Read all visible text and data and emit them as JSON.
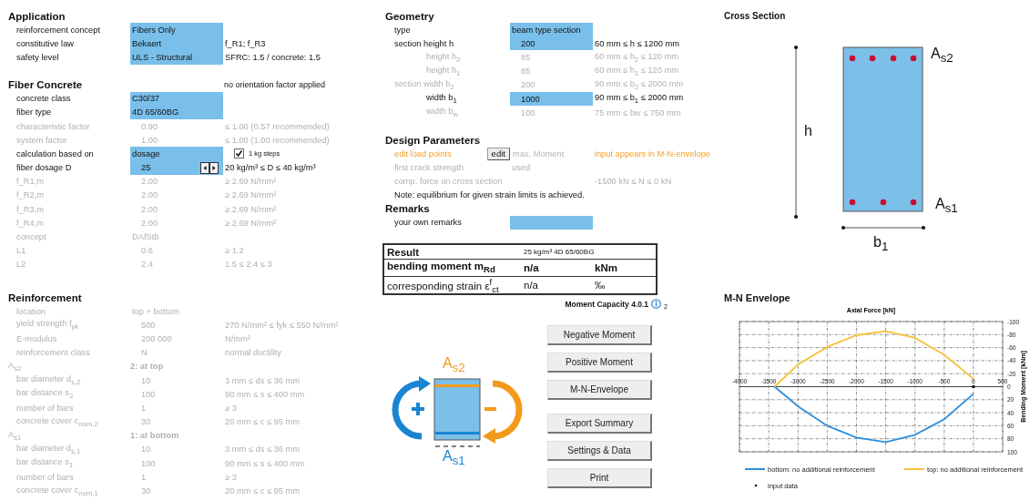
{
  "left_sections": [
    {
      "title": "Application",
      "rows": [
        {
          "label": "reinforcement concept",
          "value": "Fibers Only",
          "kind": "text",
          "input": true,
          "disabled": false
        },
        {
          "label": "constitutive law",
          "value": "Bekaert",
          "note": "f_R1; f_R3",
          "kind": "text",
          "input": true,
          "disabled": false
        },
        {
          "label": "safety level",
          "value": "ULS - Structural",
          "note": "SFRC: 1.5 / concrete: 1.5",
          "kind": "text",
          "input": true,
          "disabled": false
        }
      ]
    },
    {
      "title": "Fiber Concrete",
      "note": "no orientation factor applied",
      "rows": [
        {
          "label": "concrete class",
          "value": "C30/37",
          "kind": "text",
          "input": true,
          "disabled": false
        },
        {
          "label": "fiber type",
          "value": "4D 65/60BG",
          "kind": "text",
          "input": true,
          "disabled": false
        },
        {
          "label": "characteristic factor",
          "value": "0.90",
          "note": "≤ 1.00 (0.57 recommended)",
          "kind": "number",
          "input": false,
          "disabled": true
        },
        {
          "label": "system factor",
          "value": "1.00",
          "note": "≤ 1.00 (1.00 recommended)",
          "kind": "number",
          "input": false,
          "disabled": true
        },
        {
          "label": "calculation based on",
          "value": "dosage",
          "kind": "text",
          "input": true,
          "disabled": false,
          "checkbox": {
            "label": "1 kg steps",
            "checked": true
          }
        },
        {
          "label": "fiber dosage D",
          "value": "25",
          "note": "20 kg/m³ ≤ D ≤ 40 kg/m³",
          "kind": "stepper",
          "input": true,
          "disabled": false
        },
        {
          "label": "f_R1,m",
          "value": "2.00",
          "note": "≥ 2.69 N/mm²",
          "kind": "number",
          "input": false,
          "disabled": true
        },
        {
          "label": "f_R2,m",
          "value": "2.00",
          "note": "≥ 2.69 N/mm²",
          "kind": "number",
          "input": false,
          "disabled": true
        },
        {
          "label": "f_R3,m",
          "value": "2.00",
          "note": "≥ 2.69 N/mm²",
          "kind": "number",
          "input": false,
          "disabled": true
        },
        {
          "label": "f_R4,m",
          "value": "2.00",
          "note": "≥ 2.69 N/mm²",
          "kind": "number",
          "input": false,
          "disabled": true
        },
        {
          "label": "concept",
          "value": "DAfStb",
          "kind": "text",
          "input": false,
          "disabled": true
        },
        {
          "label": "L1",
          "value": "0.6",
          "note": "≥ 1.2",
          "kind": "number",
          "input": false,
          "disabled": true
        },
        {
          "label": "L2",
          "value": "2.4",
          "note": "1.5 ≤ 2.4 ≤ 3",
          "kind": "number",
          "input": false,
          "disabled": true
        }
      ]
    },
    {
      "title": "Reinforcement",
      "rows": [
        {
          "label": "location",
          "value": "top + bottom",
          "kind": "text",
          "input": false,
          "disabled": true
        },
        {
          "label": "yield strength f$_{yk}$",
          "value": "500",
          "note": "270 N/mm² ≤ fyk ≤ 550 N/mm²",
          "kind": "number",
          "input": false,
          "disabled": true
        },
        {
          "label": "E-modulus",
          "value": "200 000",
          "note": "N/mm²",
          "kind": "number",
          "input": false,
          "disabled": true
        },
        {
          "label": "reinforcement class",
          "value": "N",
          "note": "normal ductility",
          "kind": "number",
          "input": false,
          "disabled": true
        },
        {
          "label": "A$_{s2}$",
          "value": "2: at top",
          "kind": "group",
          "input": false,
          "disabled": true,
          "children": [
            {
              "label": "bar diameter d$_{s,2}$",
              "value": "10",
              "note": "3 mm ≤ ds ≤ 36 mm",
              "kind": "number",
              "input": false,
              "disabled": true
            },
            {
              "label": "bar distance s$_{2}$",
              "value": "100",
              "note": "90 mm ≤ s ≤ 400 mm",
              "kind": "number",
              "input": false,
              "disabled": true
            },
            {
              "label": "number of bars",
              "value": "1",
              "note": "≥ 3",
              "kind": "number",
              "input": false,
              "disabled": true
            },
            {
              "label": "concrete cover c$_{nom,2}$",
              "value": "30",
              "note": "20 mm ≤ c ≤ 95 mm",
              "kind": "number",
              "input": false,
              "disabled": true
            }
          ]
        },
        {
          "label": "A$_{s1}$",
          "value": "1: at bottom",
          "kind": "group",
          "input": false,
          "disabled": true,
          "children": [
            {
              "label": "bar diameter d$_{s,1}$",
              "value": "10",
              "note": "3 mm ≤ ds ≤ 36 mm",
              "kind": "number",
              "input": false,
              "disabled": true
            },
            {
              "label": "bar distance s$_{1}$",
              "value": "100",
              "note": "90 mm ≤ s ≤ 400 mm",
              "kind": "number",
              "input": false,
              "disabled": true
            },
            {
              "label": "number of bars",
              "value": "1",
              "note": "≥ 3",
              "kind": "number",
              "input": false,
              "disabled": true
            },
            {
              "label": "concrete cover c$_{nom,1}$",
              "value": "30",
              "note": "20 mm ≤ c ≤ 95 mm",
              "kind": "number",
              "input": false,
              "disabled": true
            }
          ]
        }
      ]
    }
  ],
  "middle_sections": [
    {
      "title": "Geometry",
      "rows": [
        {
          "label": "type",
          "value": "beam type section",
          "kind": "text",
          "input": true,
          "disabled": false
        },
        {
          "label": "section height h",
          "value": "200",
          "note": "60 mm ≤ h ≤ 1200 mm",
          "kind": "number",
          "input": true,
          "disabled": false,
          "children": [
            {
              "label": "height h$_{2}$",
              "value": "85",
              "note": "60 mm ≤ h$_{2}$ ≤ 120 mm",
              "kind": "number",
              "input": false,
              "disabled": true
            },
            {
              "label": "height h$_{1}$",
              "value": "85",
              "note": "60 mm ≤ h$_{1}$ ≤ 120 mm",
              "kind": "number",
              "input": false,
              "disabled": true
            }
          ]
        },
        {
          "label": "section width b$_{2}$",
          "value": "200",
          "note": "90 mm ≤ b$_{2}$ ≤ 2000 mm",
          "kind": "number",
          "input": false,
          "disabled": true,
          "children": [
            {
              "label": "width b$_{1}$",
              "value": "1000",
              "note": "90 mm ≤ b$_{1}$ ≤ 2000 mm",
              "kind": "number",
              "input": true,
              "disabled": false
            },
            {
              "label": "width b$_{w}$",
              "value": "100",
              "note": "75 mm ≤ bw ≤ 750 mm",
              "kind": "number",
              "input": false,
              "disabled": true
            }
          ]
        }
      ]
    },
    {
      "title": "Design Parameters",
      "footnote": "Note: equilibrium for given strain limits is achieved.",
      "rows": [
        {
          "label": "edit load points",
          "button": "edit",
          "value": "max. Moment",
          "note": "input appears in M-N-envelope",
          "kind": "action",
          "input": false,
          "disabled": false
        },
        {
          "label": "first crack strength",
          "value": "used",
          "kind": "text",
          "input": false,
          "disabled": true
        },
        {
          "label": "comp. force on cross section",
          "note": "-1500 kN ≤ N ≤ 0 kN",
          "kind": "text",
          "input": false,
          "disabled": true
        }
      ]
    },
    {
      "title": "Remarks",
      "rows": [
        {
          "label": "your own remarks",
          "kind": "text",
          "input": true,
          "disabled": false
        }
      ]
    }
  ],
  "result": {
    "title": "Result",
    "subtitle": "25 kg/m³ 4D 65/60BG",
    "rows": [
      {
        "label": "bending moment m$_{Rd}$",
        "value": "n/a",
        "unit": "kNm",
        "emphasis": true
      },
      {
        "label": "corresponding strain ε$^{f}$$_{ct}$",
        "value": "n/a",
        "unit": "‰",
        "emphasis": false
      }
    ]
  },
  "version": {
    "name": "Moment Capacity 4.0.1",
    "suffix": "2"
  },
  "moment_diagram": {
    "top_label": "A$_{s2}$",
    "bottom_label": "A$_{s1}$"
  },
  "button_groups": [
    [
      "Negative Moment",
      "Positive Moment",
      "M-N-Envelope"
    ],
    [
      "Export Summary",
      "Settings & Data",
      "Print"
    ]
  ],
  "cross_section": {
    "title": "Cross Section",
    "height_label": "h",
    "width_label": "b$_{1}$",
    "top_label": "A$_{s2}$",
    "bottom_label": "A$_{s1}$"
  },
  "envelope": {
    "title": "M-N Envelope",
    "chart_data": {
      "type": "line",
      "xlabel": "Axial Force [kN]",
      "ylabel": "Bending Moment [kNm]",
      "x": [
        -3400,
        -3000,
        -2500,
        -2000,
        -1500,
        -1000,
        -500,
        0
      ],
      "series": [
        {
          "name": "bottom: no additional reinforcement",
          "color": "#2e8fdc",
          "values": [
            0,
            30,
            60,
            78,
            85,
            74,
            50,
            11
          ]
        },
        {
          "name": "top: no additional reinforcement",
          "color": "#f7c139",
          "values": [
            0,
            -34,
            -61,
            -79,
            -85,
            -75,
            -49,
            -12
          ]
        }
      ],
      "xlim": [
        -4000,
        500
      ],
      "ylim": [
        100,
        -100
      ],
      "xticks": [
        -4000,
        -3500,
        -3000,
        -2500,
        -2000,
        -1500,
        -1000,
        -500,
        0,
        {
          "value": 500,
          "label": "500"
        }
      ],
      "yticks": [
        -100,
        -80,
        -60,
        -40,
        -20,
        0,
        20,
        40,
        60,
        80,
        {
          "value": 100,
          "label": "100"
        }
      ],
      "grid": true,
      "legend": true,
      "annotations": [
        "input data"
      ]
    }
  }
}
